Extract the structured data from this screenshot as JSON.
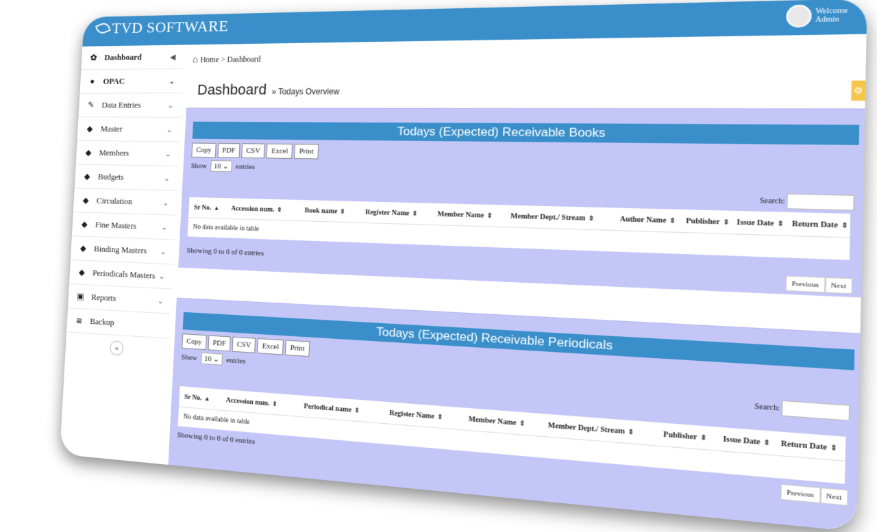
{
  "app": {
    "brand": "TVD SOFTWARE"
  },
  "user": {
    "greeting": "Welcome",
    "name": "Admin"
  },
  "sidebar": {
    "items": [
      {
        "label": "Dashboard",
        "icon": "palette-icon"
      },
      {
        "label": "OPAC",
        "icon": "user-icon"
      },
      {
        "label": "Data Entries",
        "icon": "pencil-icon"
      },
      {
        "label": "Master",
        "icon": "tag-icon"
      },
      {
        "label": "Members",
        "icon": "tag-icon"
      },
      {
        "label": "Budgets",
        "icon": "tag-icon"
      },
      {
        "label": "Circulation",
        "icon": "tag-icon"
      },
      {
        "label": "Fine Masters",
        "icon": "tag-icon"
      },
      {
        "label": "Binding Masters",
        "icon": "tag-icon"
      },
      {
        "label": "Periodicals Masters",
        "icon": "tag-icon"
      },
      {
        "label": "Reports",
        "icon": "money-icon"
      },
      {
        "label": "Backup",
        "icon": "database-icon"
      }
    ],
    "collapse_glyph": "«"
  },
  "breadcrumb": {
    "home": "Home",
    "sep": ">",
    "current": "Dashboard"
  },
  "page": {
    "title": "Dashboard",
    "subtitle": "» Todays Overview"
  },
  "books": {
    "title": "Todays (Expected) Receivable Books",
    "buttons": [
      "Copy",
      "PDF",
      "CSV",
      "Excel",
      "Print"
    ],
    "show_label": "Show",
    "entries_value": "10",
    "entries_label": "entries",
    "search_label": "Search:",
    "columns": [
      "Sr No.",
      "Accession num.",
      "Book name",
      "Register Name",
      "Member Name",
      "Member Dept./ Stream",
      "Author Name",
      "Publisher",
      "Issue Date",
      "Return Date"
    ],
    "empty_text": "No data available in table",
    "info": "Showing 0 to 0 of 0 entries",
    "prev": "Previous",
    "next": "Next"
  },
  "periodicals": {
    "title": "Todays (Expected) Receivable Periodicals",
    "buttons": [
      "Copy",
      "PDF",
      "CSV",
      "Excel",
      "Print"
    ],
    "show_label": "Show",
    "entries_value": "10",
    "entries_label": "entries",
    "search_label": "Search:",
    "columns": [
      "Sr No.",
      "Accession num.",
      "Periodical name",
      "Register Name",
      "Member Name",
      "Member Dept./ Stream",
      "Publisher",
      "Issue Date",
      "Return Date"
    ],
    "empty_text": "No data available in table",
    "info": "Showing 0 to 0 of 0 entries",
    "prev": "Previous",
    "next": "Next"
  },
  "colors": {
    "accent": "#3a8fca",
    "panel": "#c3c6f7",
    "gear": "#f6c64a"
  }
}
